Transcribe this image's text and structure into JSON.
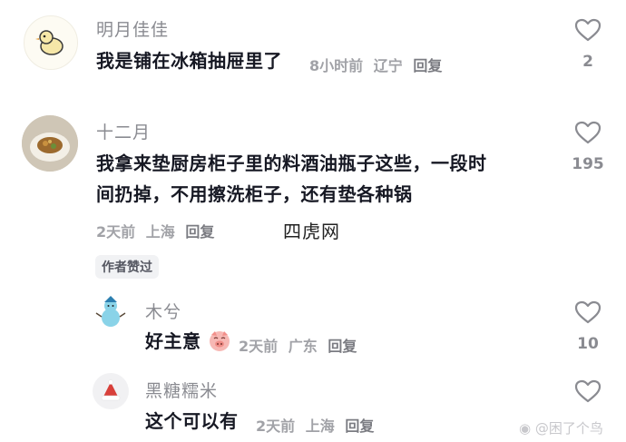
{
  "comments": [
    {
      "username": "明月佳佳",
      "text": "我是铺在冰箱抽屉里了",
      "time": "8小时前",
      "location": "辽宁",
      "reply_label": "回复",
      "likes": "2"
    },
    {
      "username": "十二月",
      "text_line1": "我拿来垫厨房柜子里的料酒油瓶子这些，一段时",
      "text_line2": "间扔掉，不用擦洗柜子，还有垫各种锅",
      "time": "2天前",
      "location": "上海",
      "reply_label": "回复",
      "likes": "195",
      "badge": "作者赞过"
    },
    {
      "username": "木兮",
      "text": "好主意",
      "time": "2天前",
      "location": "广东",
      "reply_label": "回复",
      "likes": "10"
    },
    {
      "username": "黑糖糯米",
      "text": "这个可以有",
      "time": "2天前",
      "location": "上海",
      "reply_label": "回复",
      "likes": ""
    }
  ],
  "overlay": {
    "site_watermark": "四虎网"
  },
  "watermark": {
    "text": "@困了个鸟"
  },
  "colors": {
    "text": "#161823",
    "secondary": "#8a8b91",
    "meta": "#a1a2a7",
    "badge_bg": "#f1f2f4"
  }
}
